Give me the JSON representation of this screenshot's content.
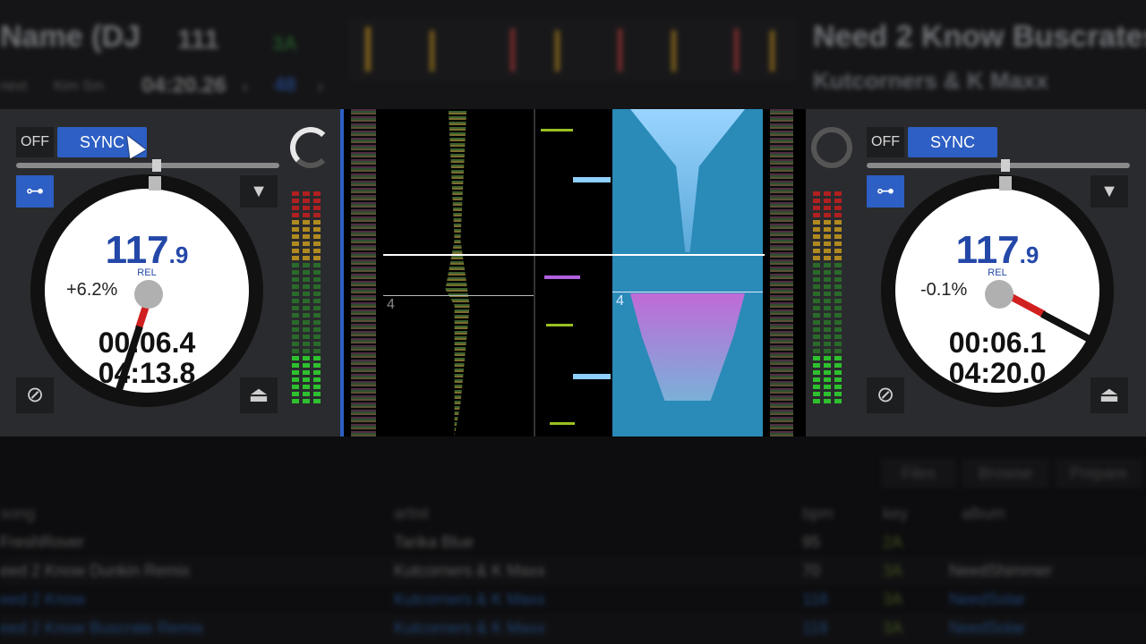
{
  "header": {
    "left_title": "Name (DJ",
    "left_bpm": "111",
    "left_key": "3A",
    "left_time": "04:20.26",
    "left_small_1": "next",
    "left_small_2": "Kim Sm",
    "left_deck_num": "48",
    "right_title": "Need 2 Know Buscrates",
    "right_artist": "Kutcorners & K Maxx"
  },
  "deck_left": {
    "off_label": "OFF",
    "sync_label": "SYNC",
    "loop_icon": "⊶",
    "menu_icon": "▼",
    "edit_icon": "⊘",
    "eject_icon": "⏏",
    "bpm_main": "117",
    "bpm_frac": ".9",
    "rel_label": "REL",
    "pitch": "+6.2%",
    "time_elapsed": "00:06.4",
    "time_remaining": "04:13.8"
  },
  "deck_right": {
    "off_label": "OFF",
    "sync_label": "SYNC",
    "loop_icon": "⊶",
    "menu_icon": "▼",
    "edit_icon": "⊘",
    "eject_icon": "⏏",
    "bpm_main": "117",
    "bpm_frac": ".9",
    "rel_label": "REL",
    "pitch": "-0.1%",
    "time_elapsed": "00:06.1",
    "time_remaining": "04:20.0"
  },
  "waveform": {
    "left_marker": "4",
    "right_marker": "4"
  },
  "library": {
    "tabs": [
      "Files",
      "Browse",
      "Prepare"
    ],
    "columns": {
      "song": "song",
      "artist": "artist",
      "bpm": "bpm",
      "key": "key",
      "album": "album"
    },
    "rows": [
      {
        "song": "FreshRover",
        "artist": "Tarika Blue",
        "bpm": "95",
        "key": "2A",
        "album": ""
      },
      {
        "song": "eed 2 Know Dunkin Remix",
        "artist": "Kutcorners & K Maxx",
        "bpm": "70",
        "key": "3A",
        "album": "NeedShimmer"
      },
      {
        "song": "eed 2 Know",
        "artist": "Kutcorners & K Maxx",
        "bpm": "118",
        "key": "3A",
        "album": "NeedSolar",
        "highlight": true
      },
      {
        "song": "eed 2 Know Buscrate Remix",
        "artist": "Kutcorners & K Maxx",
        "bpm": "118",
        "key": "3A",
        "album": "NeedSolar",
        "highlight": true
      }
    ]
  },
  "colors": {
    "accent": "#2d5fc4",
    "bpm_text": "#2448a8",
    "needle_red": "#d02020",
    "deck_bg": "#2a2b2e"
  }
}
